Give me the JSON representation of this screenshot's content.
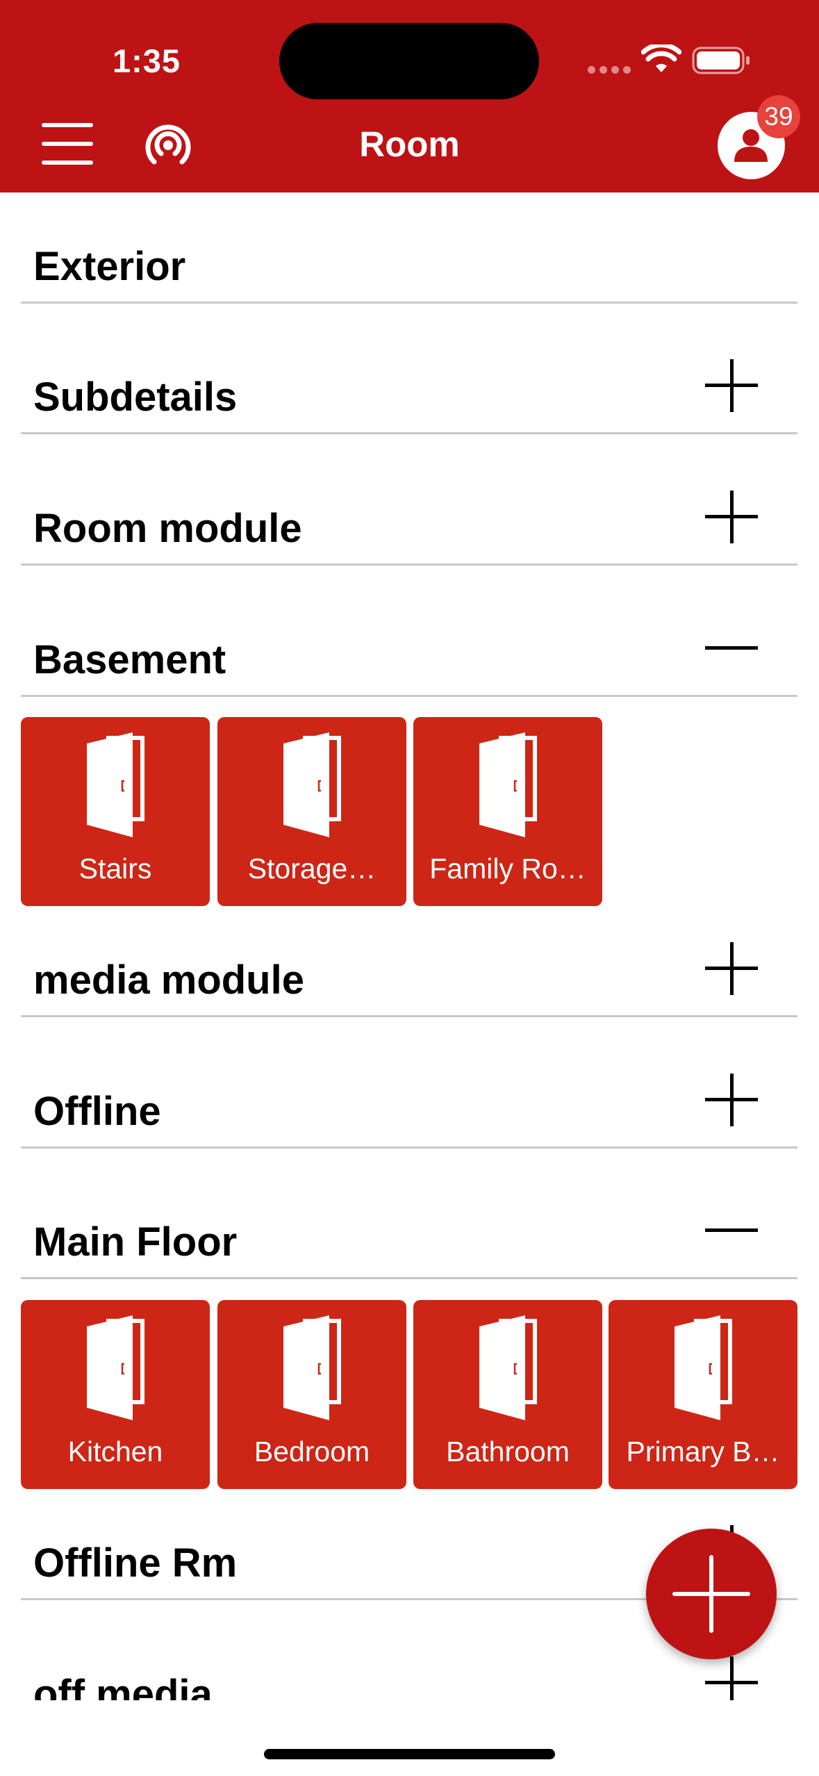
{
  "colors": {
    "brand": "#bd1314",
    "tile": "#cd2616",
    "badge": "#e8423c"
  },
  "status_bar": {
    "time": "1:35",
    "icons": [
      "cellular-dots-icon",
      "wifi-icon",
      "battery-icon"
    ]
  },
  "header": {
    "title": "Room",
    "left_icons": [
      "menu-icon",
      "broadcast-icon"
    ],
    "right_icon": "user-icon",
    "notification_count": "39"
  },
  "sections": [
    {
      "title": "Exterior",
      "toggle": "none"
    },
    {
      "title": "Subdetails",
      "toggle": "plus-icon"
    },
    {
      "title": "Room module",
      "toggle": "plus-icon"
    },
    {
      "title": "Basement",
      "toggle": "minus-icon",
      "rooms": [
        "Stairs",
        "Storage…",
        "Family Ro…"
      ]
    },
    {
      "title": "media module",
      "toggle": "plus-icon"
    },
    {
      "title": "Offline",
      "toggle": "plus-icon"
    },
    {
      "title": "Main Floor",
      "toggle": "minus-icon",
      "rooms": [
        "Kitchen",
        "Bedroom",
        "Bathroom",
        "Primary B…"
      ]
    },
    {
      "title": "Offline Rm",
      "toggle": "plus-icon"
    },
    {
      "title": "off media",
      "toggle": "plus-icon"
    }
  ],
  "room_icon": "door-icon",
  "fab_icon": "add-icon"
}
